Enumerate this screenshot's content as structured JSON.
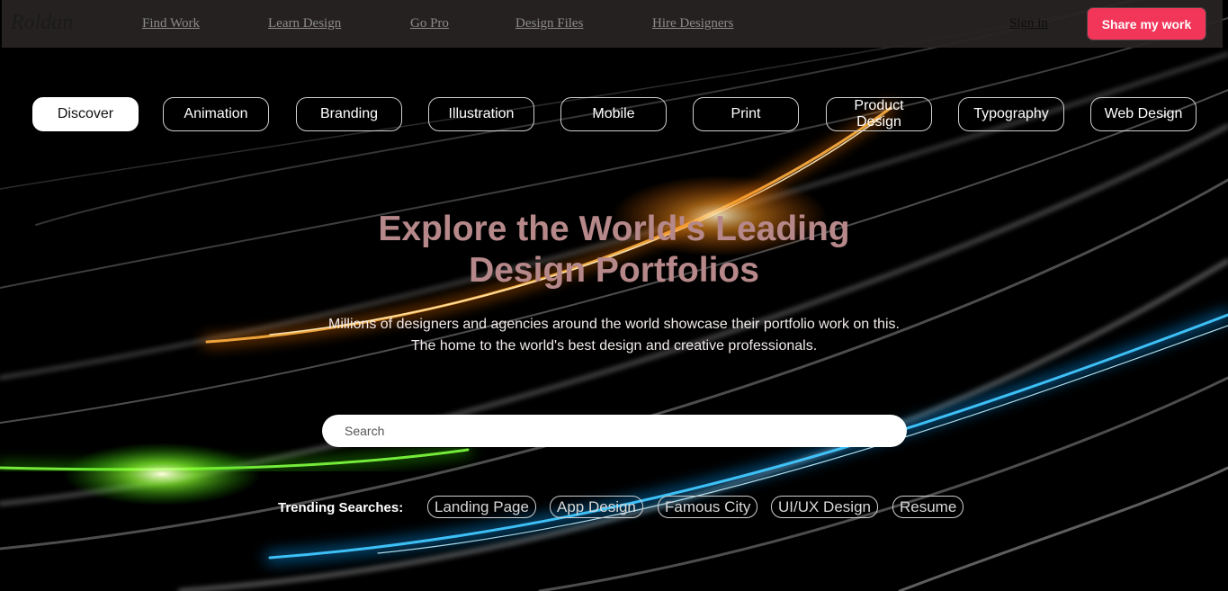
{
  "nav": {
    "logo": "Roldan",
    "links": [
      "Find Work",
      "Learn Design",
      "Go Pro",
      "Design Files",
      "Hire Designers"
    ],
    "signin": "Sign in",
    "share_label": "Share my work"
  },
  "categories": [
    {
      "label": "Discover",
      "active": true
    },
    {
      "label": "Animation"
    },
    {
      "label": "Branding"
    },
    {
      "label": "Illustration"
    },
    {
      "label": "Mobile"
    },
    {
      "label": "Print"
    },
    {
      "label": "Product Design"
    },
    {
      "label": "Typography"
    },
    {
      "label": "Web Design"
    }
  ],
  "hero": {
    "title_line1": "Explore the World's Leading",
    "title_line2": "Design Portfolios",
    "sub_line1": "Millions of designers and agencies around the world showcase their portfolio work on this.",
    "sub_line2": "The home to the world's best design and creative professionals."
  },
  "search": {
    "placeholder": "Search"
  },
  "trending": {
    "label": "Trending Searches:",
    "items": [
      "Landing Page",
      "App Design",
      "Famous City",
      "UI/UX Design",
      "Resume"
    ]
  },
  "colors": {
    "accent": "#f2365a",
    "title": "#b6888a"
  }
}
